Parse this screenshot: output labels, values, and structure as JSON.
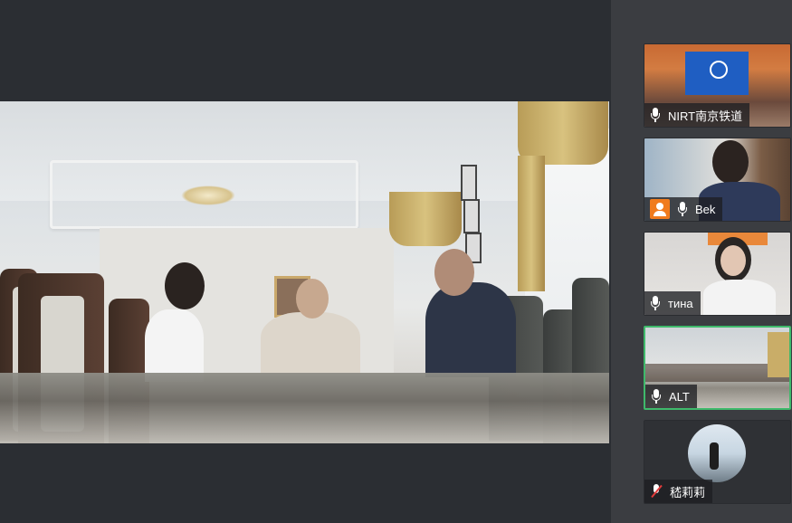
{
  "main_video": {
    "speaker": "ALT"
  },
  "participants": [
    {
      "name": "NIRT南京铁道",
      "mic": "mic-icon",
      "muted": false,
      "host": false,
      "active": false
    },
    {
      "name": "Bek",
      "mic": "mic-icon",
      "muted": false,
      "host": true,
      "active": false
    },
    {
      "name": "тина",
      "mic": "mic-icon",
      "muted": false,
      "host": false,
      "active": false
    },
    {
      "name": "ALT",
      "mic": "mic-icon",
      "muted": false,
      "host": false,
      "active": true
    },
    {
      "name": "嵇莉莉",
      "mic": "mic-muted-icon",
      "muted": true,
      "host": false,
      "active": false
    }
  ],
  "colors": {
    "active_border": "#3fb96b",
    "host_badge": "#f07b1d",
    "muted_slash": "#e33b3b",
    "background": "#2f3237"
  }
}
